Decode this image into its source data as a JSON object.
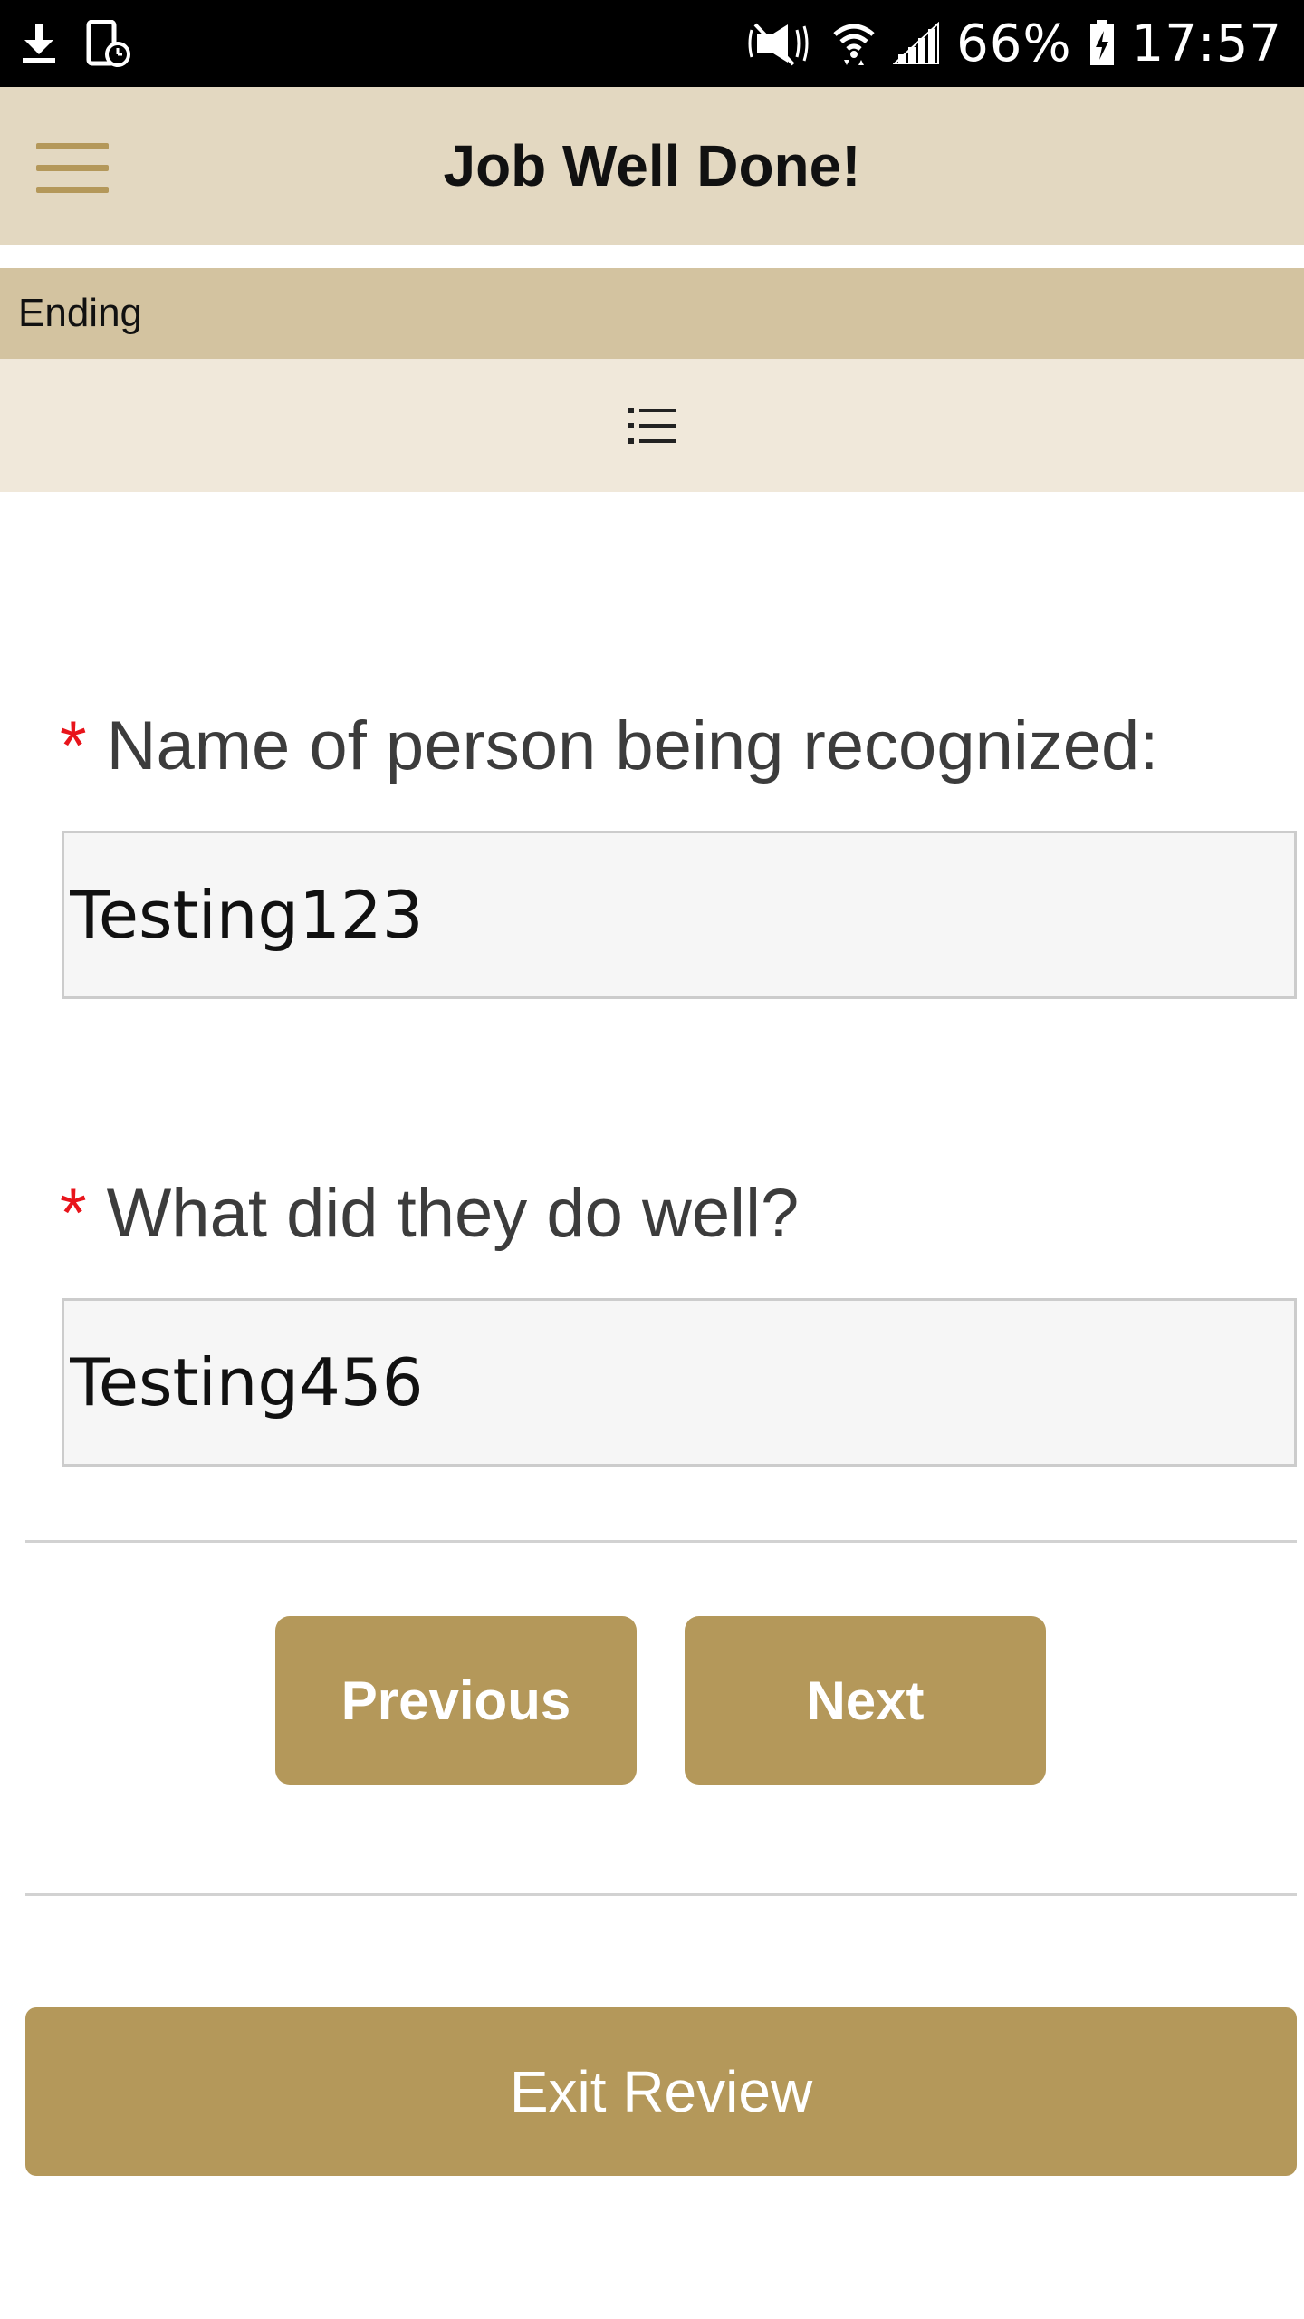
{
  "status_bar": {
    "battery": "66%",
    "time": "17:57",
    "icons": [
      "download-icon",
      "screenshot-icon",
      "mute-icon",
      "wifi-icon",
      "signal-icon",
      "battery-icon"
    ]
  },
  "header": {
    "title": "Job Well Done!",
    "menu_icon": "hamburger-menu-icon"
  },
  "section": {
    "label": "Ending",
    "toc_icon": "list-icon"
  },
  "form": {
    "required_marker": "*",
    "fields": [
      {
        "label": "Name of person being recognized:",
        "value": "Testing123"
      },
      {
        "label": "What did they do well?",
        "value": "Testing456"
      }
    ]
  },
  "navigation": {
    "previous_label": "Previous",
    "next_label": "Next",
    "exit_label": "Exit Review"
  },
  "colors": {
    "accent": "#b4985a",
    "header_bg": "#e3d8c1",
    "section_bg": "#d3c3a0",
    "toc_bg": "#f0e8da",
    "required": "#e8141b"
  }
}
